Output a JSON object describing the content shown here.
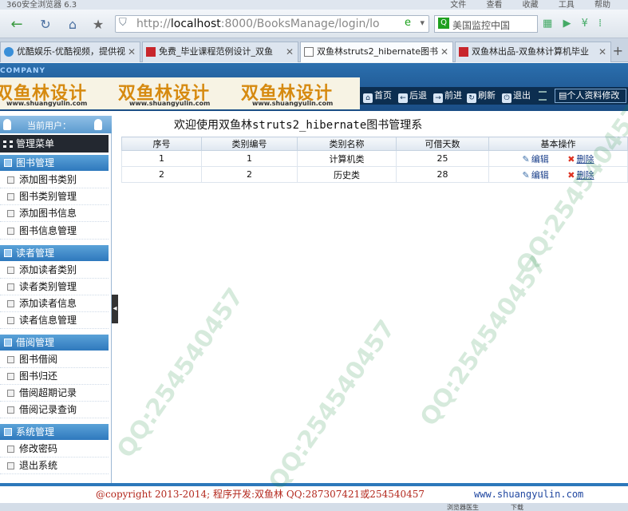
{
  "browser": {
    "app_title": "360安全浏览器 6.3",
    "menus": [
      "文件",
      "查看",
      "收藏",
      "工具",
      "帮助"
    ],
    "url_host": "localhost",
    "url_prefix": "http://",
    "url_rest": ":8000/BooksManage/login/lo",
    "search_text": "美国监控中国",
    "tabs": [
      {
        "label": "优酷娱乐-优酷视频，提供视频",
        "active": false
      },
      {
        "label": "免费_毕业课程范例设计_双鱼",
        "active": false
      },
      {
        "label": "双鱼林struts2_hibernate图书",
        "active": true
      },
      {
        "label": "双鱼林出品-双鱼林计算机毕业",
        "active": false
      }
    ]
  },
  "header": {
    "company": "COMPANY",
    "banner_title": "双鱼林设计",
    "banner_url": "www.shuangyulin.com",
    "nav": [
      {
        "label": "首页",
        "icon": "home-icon",
        "glyph": "⌂"
      },
      {
        "label": "后退",
        "icon": "back-icon",
        "glyph": "←"
      },
      {
        "label": "前进",
        "icon": "forward-icon",
        "glyph": "→"
      },
      {
        "label": "刷新",
        "icon": "refresh-icon",
        "glyph": "↻"
      },
      {
        "label": "退出",
        "icon": "power-icon",
        "glyph": "⏻"
      }
    ],
    "profile_label": "个人资料修改"
  },
  "sidebar": {
    "current_user_label": "当前用户：",
    "menu_title": "管理菜单",
    "groups": [
      {
        "title": "图书管理",
        "items": [
          "添加图书类别",
          "图书类别管理",
          "添加图书信息",
          "图书信息管理"
        ]
      },
      {
        "title": "读者管理",
        "items": [
          "添加读者类别",
          "读者类别管理",
          "添加读者信息",
          "读者信息管理"
        ]
      },
      {
        "title": "借阅管理",
        "items": [
          "图书借阅",
          "图书归还",
          "借阅超期记录",
          "借阅记录查询"
        ]
      },
      {
        "title": "系统管理",
        "items": [
          "修改密码",
          "退出系统"
        ]
      }
    ]
  },
  "main": {
    "welcome": "欢迎使用双鱼林struts2_hibernate图书管理系",
    "table": {
      "columns": [
        "序号",
        "类别编号",
        "类别名称",
        "可借天数",
        "基本操作"
      ],
      "rows": [
        [
          "1",
          "1",
          "计算机类",
          "25"
        ],
        [
          "2",
          "2",
          "历史类",
          "28"
        ]
      ],
      "edit_label": "编辑",
      "delete_label": "删除"
    }
  },
  "footer": {
    "copyright": "@copyright 2013-2014; 程序开发:双鱼林  QQ:287307421或254540457",
    "site": "www.shuangyulin.com",
    "status_left": "浏览器医生",
    "status_right": "下载"
  },
  "watermark": {
    "text": "QQ:254540457"
  }
}
